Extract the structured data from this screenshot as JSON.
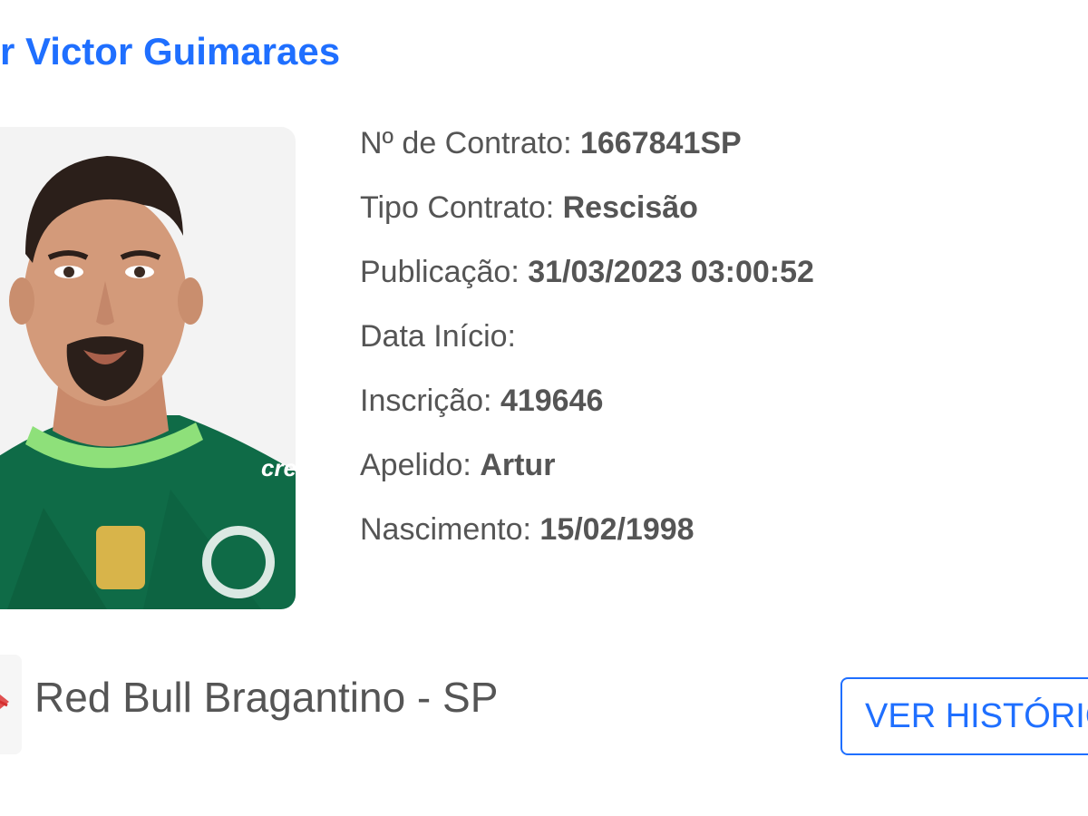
{
  "player": {
    "name": "r Victor Guimaraes"
  },
  "details": [
    {
      "label": "Nº de Contrato: ",
      "value": "1667841SP"
    },
    {
      "label": "Tipo Contrato: ",
      "value": "Rescisão"
    },
    {
      "label": "Publicação: ",
      "value": "31/03/2023 03:00:52"
    },
    {
      "label": "Data Início: ",
      "value": ""
    },
    {
      "label": "Inscrição: ",
      "value": "419646"
    },
    {
      "label": "Apelido: ",
      "value": "Artur"
    },
    {
      "label": "Nascimento: ",
      "value": "15/02/1998"
    }
  ],
  "club": {
    "name": "Red Bull Bragantino - SP"
  },
  "actions": {
    "history_label": "VER HISTÓRICO"
  },
  "colors": {
    "accent": "#1f6fff",
    "text": "#555555",
    "jersey": "#0f6b47"
  },
  "icons": {
    "player_photo": "player-photo",
    "club_logo": "club-logo-icon"
  }
}
